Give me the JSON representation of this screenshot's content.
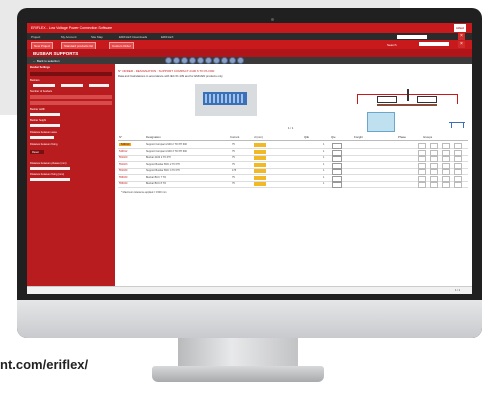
{
  "page": {
    "url_fragment": "nt.com/eriflex/"
  },
  "app": {
    "title": "ERIFLEX - Low Voltage Power Connection Software",
    "logo_text": "nVent"
  },
  "menu": {
    "items": [
      "Project",
      "My Account",
      "Site Map",
      "ERIFLEX Downloads",
      "ERIFLEX"
    ],
    "search_label": "Search"
  },
  "toolbar": {
    "buttons": [
      "New Project",
      "Standard products list",
      "Custom Order"
    ]
  },
  "section": {
    "heading": "BUSBAR SUPPORTS",
    "back_link": "← Back to selection"
  },
  "sidebar": {
    "group_title": "Busbar Settings",
    "labels": [
      "Busbars",
      "Number of busbars",
      "Busbar width",
      "Busbar height",
      "Distance between axes",
      "Distance between fixing"
    ],
    "button_label": "Reset",
    "links": [
      "Distance between phases (mm)",
      "Distance between fixing (mm)"
    ]
  },
  "content": {
    "designation": "N° ORDER - DESIGNATION : SUPPORT COMPACT 2100 6 TO PH 600",
    "subtitle": "Data and Calculations in accordance with IEC 61 439 and for EMC/EN products only",
    "table": {
      "headers": [
        "N°",
        "Designation",
        "Current",
        "d (mm)",
        "QtE",
        "Qte",
        "Freight",
        "Phase",
        "Groups"
      ],
      "rows": [
        {
          "code": "546010",
          "designation": "Support Compact 2100 2 TO PH 600",
          "current": "75",
          "qty": "1"
        },
        {
          "code": "546012",
          "designation": "Support Compact 2100 3 TO PH 600",
          "current": "75",
          "qty": "1"
        },
        {
          "code": "551020",
          "designation": "Busbar 2100 2 TO PH",
          "current": "75",
          "qty": "1"
        },
        {
          "code": "551023",
          "designation": "Support Busbar BCC 2 TO PH",
          "current": "75",
          "qty": "1"
        },
        {
          "code": "551030",
          "designation": "Support Busbar BCC 3 TO PH",
          "current": "175",
          "qty": "1"
        },
        {
          "code": "556030",
          "designation": "Busbar BCC 7 TO",
          "current": "75",
          "qty": "1"
        },
        {
          "code": "556040",
          "designation": "Busbar BCC 8 TO",
          "current": "75",
          "qty": "1"
        }
      ],
      "footer_note": "* Maximum tolerance applied = 1500 mm"
    }
  },
  "status": {
    "page_label": "1 / 1"
  },
  "colors": {
    "brand_red": "#c8191d",
    "highlight_orange": "#f7a11c",
    "button_yellow": "#f1b928"
  }
}
